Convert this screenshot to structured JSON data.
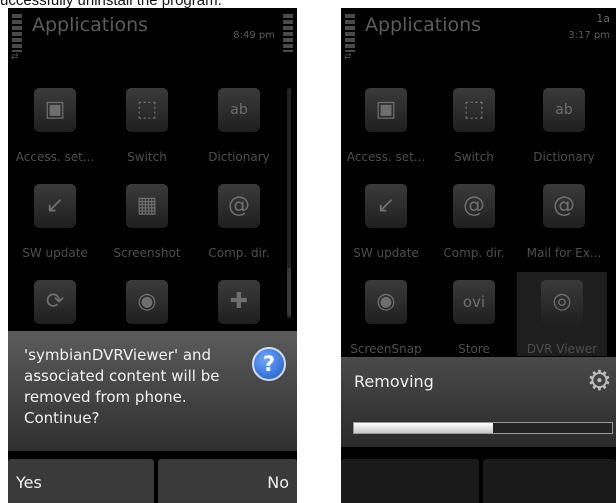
{
  "caption": "uccessfully uninstall the program.",
  "left_phone": {
    "title": "Applications",
    "time": "8:49 pm",
    "apps": [
      {
        "label": "Access. set...",
        "icon": "access-settings-icon"
      },
      {
        "label": "Switch",
        "icon": "switch-icon"
      },
      {
        "label": "Dictionary",
        "icon": "dictionary-icon"
      },
      {
        "label": "SW update",
        "icon": "sw-update-icon"
      },
      {
        "label": "Screenshot",
        "icon": "screenshot-icon"
      },
      {
        "label": "Comp. dir.",
        "icon": "comp-dir-icon"
      },
      {
        "label": "",
        "icon": "sync-icon"
      },
      {
        "label": "",
        "icon": "camera-icon"
      },
      {
        "label": "",
        "icon": "puzzle-icon"
      }
    ],
    "dialog": {
      "message": "'symbianDVRViewer' and\nassociated content will be\nremoved from phone.\nContinue?",
      "icon": "question-icon"
    },
    "softkeys": {
      "left": "Yes",
      "right": "No"
    }
  },
  "right_phone": {
    "title": "Applications",
    "time": "3:17 pm",
    "status_label": "1a",
    "apps": [
      {
        "label": "Access. set...",
        "icon": "access-settings-icon"
      },
      {
        "label": "Switch",
        "icon": "switch-icon"
      },
      {
        "label": "Dictionary",
        "icon": "dictionary-icon"
      },
      {
        "label": "SW update",
        "icon": "sw-update-icon"
      },
      {
        "label": "Comp. dir.",
        "icon": "comp-dir-icon"
      },
      {
        "label": "Mail for Ex...",
        "icon": "mail-icon"
      },
      {
        "label": "ScreenSnap",
        "icon": "camera-icon"
      },
      {
        "label": "Store",
        "icon": "ovi-store-icon",
        "badge": "ovi"
      },
      {
        "label": "DVR Viewer",
        "icon": "dvr-viewer-icon",
        "selected": true
      }
    ],
    "progress": {
      "label": "Removing",
      "value": 0.54,
      "icon": "gear-icon"
    }
  },
  "colors": {
    "dialog_top": "#5b5b5b",
    "dialog_bottom": "#2f2f2f",
    "question_blue": "#1a56c6",
    "screen_bg": "#000000"
  }
}
